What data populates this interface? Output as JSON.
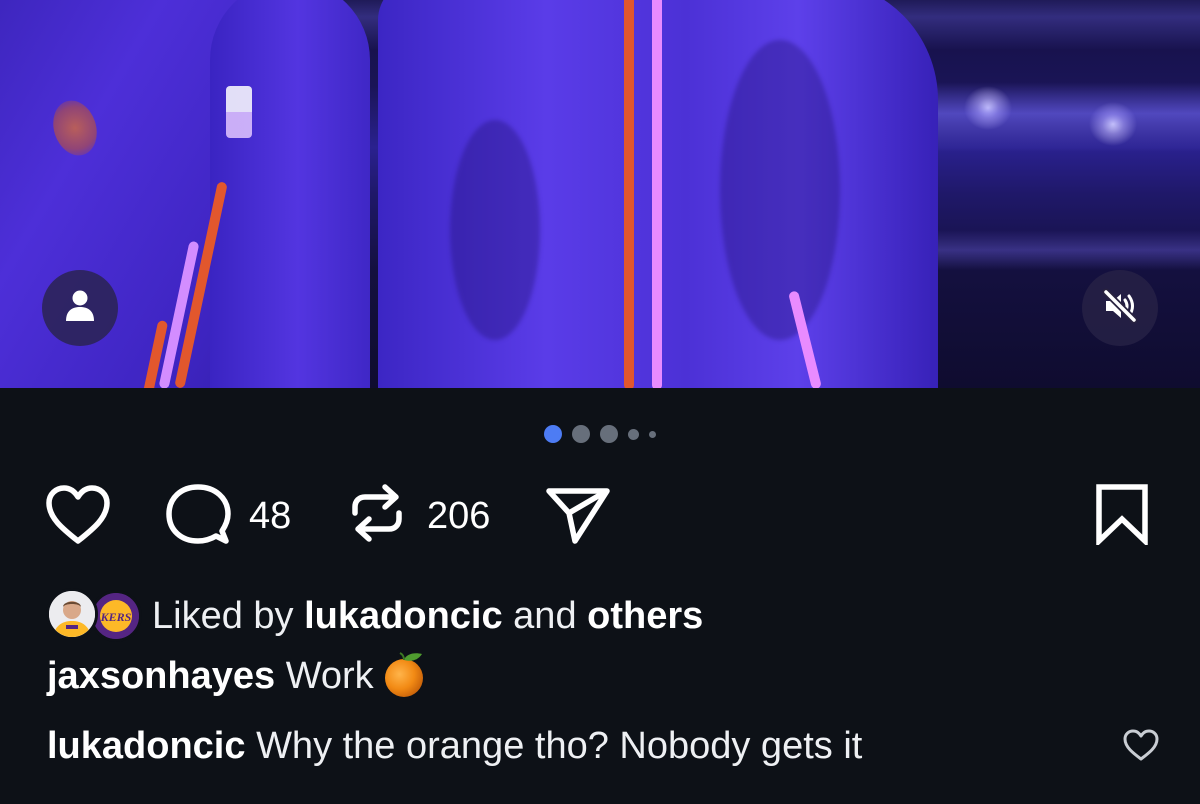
{
  "post": {
    "carousel": {
      "total": 5,
      "active": 0
    },
    "media_buttons": {
      "tag_icon": "person-icon",
      "mute_icon": "speaker-muted-icon"
    },
    "actions": {
      "like_icon": "heart-icon",
      "comment_icon": "comment-bubble-icon",
      "comment_count": "48",
      "repost_icon": "repost-icon",
      "repost_count": "206",
      "share_icon": "send-paper-plane-icon",
      "save_icon": "bookmark-icon"
    },
    "likes": {
      "prefix": "Liked by",
      "user": "lukadoncic",
      "joiner": "and",
      "others": "others"
    },
    "caption": {
      "username": "jaxsonhayes",
      "text": "Work"
    },
    "top_comment": {
      "username": "lukadoncic",
      "text": "Why the orange tho? Nobody gets it",
      "like_icon": "heart-outline-icon"
    },
    "colors": {
      "background": "#0d1117",
      "active_dot": "#4d7cf4",
      "inactive_dot": "#676f7b",
      "text": "#ffffff",
      "lakers_purple": "#552583",
      "lakers_gold": "#fdb927"
    }
  }
}
